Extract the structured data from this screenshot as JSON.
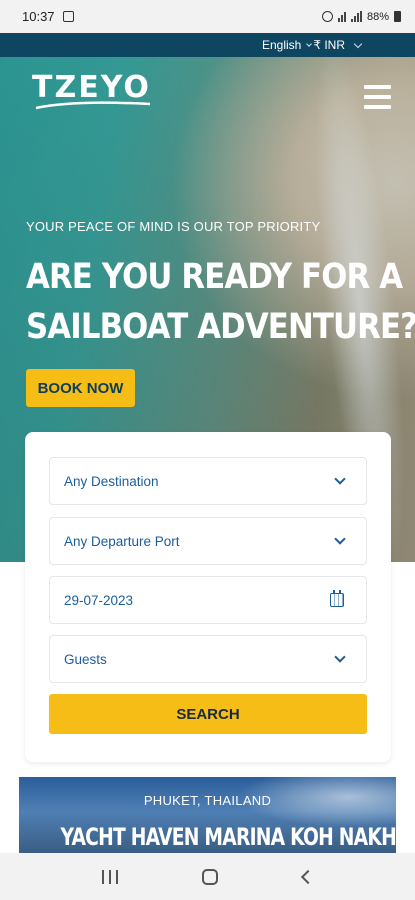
{
  "status_bar": {
    "time": "10:37",
    "battery": "88%"
  },
  "top_bar": {
    "language": "English",
    "currency": "₹ INR"
  },
  "header": {
    "logo_text": "TZEYO"
  },
  "hero": {
    "tagline": "YOUR PEACE OF MIND IS OUR TOP PRIORITY",
    "headline_line1": "ARE YOU READY FOR A",
    "headline_line2": "SAILBOAT ADVENTURE?",
    "book_now_label": "BOOK NOW"
  },
  "search_form": {
    "destination": "Any Destination",
    "departure_port": "Any Departure Port",
    "date": "29-07-2023",
    "guests": "Guests",
    "search_label": "SEARCH"
  },
  "promo": {
    "location": "PHUKET, THAILAND",
    "title": "YACHT HAVEN MARINA KOH NAKHA YAI"
  },
  "colors": {
    "accent": "#f6bd16",
    "topbar": "#0e4561",
    "field_text": "#1c5d9a"
  }
}
